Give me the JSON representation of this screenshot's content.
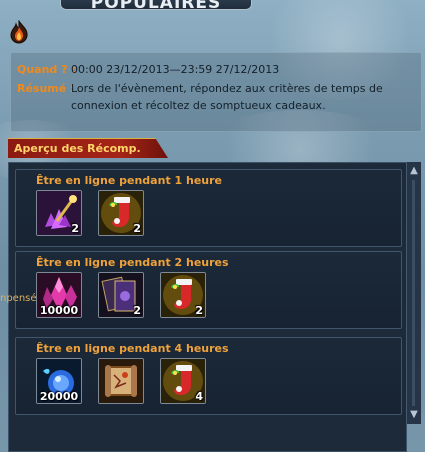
{
  "window": {
    "title": "POPULAIRES"
  },
  "info": {
    "when_label": "Quand ? :",
    "when_value": "00:00 23/12/2013—23:59 27/12/2013",
    "summary_label": "Résumé :",
    "summary_value": "Lors de l'évènement, répondez aux critères de temps de connexion et récoltez de somptueux cadeaux."
  },
  "rewards": {
    "header": "Aperçu des Récomp.",
    "cards": [
      {
        "title": "Être en ligne pendant 1 heure",
        "items": [
          {
            "icon": "purple-gem-wand-icon",
            "qty": "2"
          },
          {
            "icon": "christmas-stocking-icon",
            "qty": "2"
          }
        ]
      },
      {
        "title": "Être en ligne pendant 2 heures",
        "items": [
          {
            "icon": "pink-crystal-icon",
            "qty": "10000"
          },
          {
            "icon": "purple-card-icon",
            "qty": "2"
          },
          {
            "icon": "christmas-stocking-icon",
            "qty": "2"
          }
        ]
      },
      {
        "title": "Être en ligne pendant 4 heures",
        "items": [
          {
            "icon": "blue-orb-icon",
            "qty": "20000"
          },
          {
            "icon": "treasure-scroll-icon",
            "qty": ""
          },
          {
            "icon": "christmas-stocking-icon",
            "qty": "4"
          }
        ]
      }
    ]
  },
  "side_label": "npensé",
  "colors": {
    "label_orange": "#f08a1a",
    "card_title": "#f0a23a",
    "header_red": "#a62418",
    "header_text": "#ffd56a"
  }
}
